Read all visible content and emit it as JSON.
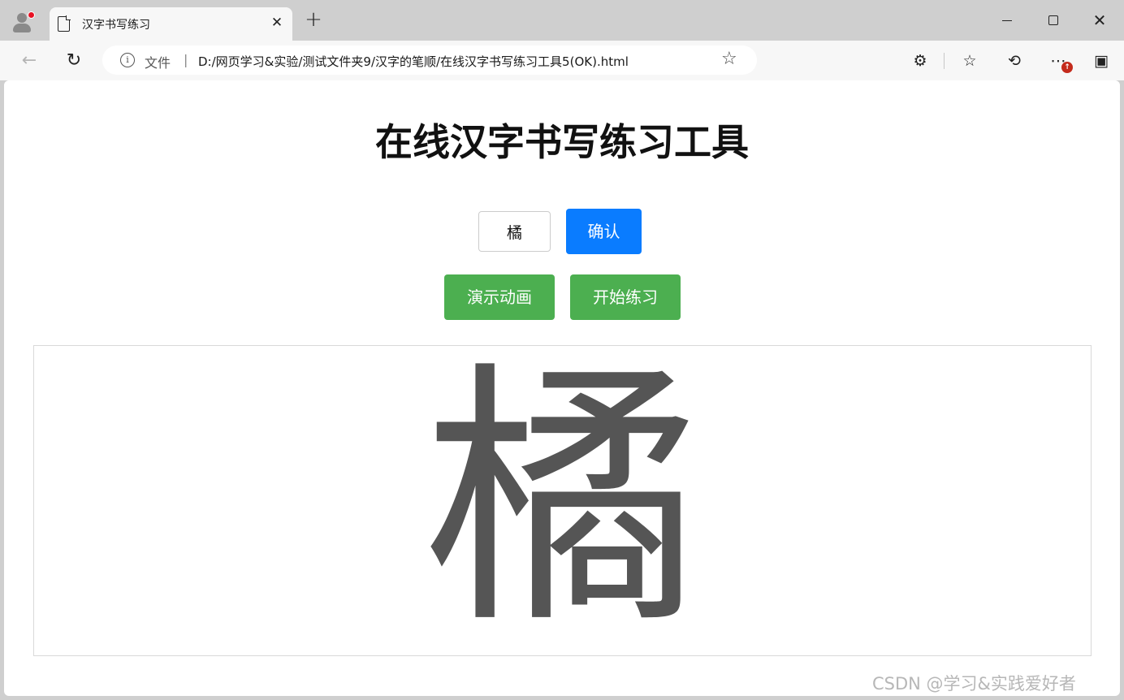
{
  "browser": {
    "tab_title": "汉字书写练习",
    "tab_close": "✕",
    "new_tab": "+",
    "address": {
      "scheme_label": "文件",
      "separator": "|",
      "url": "D:/网页学习&实验/测试文件夹9/汉字的笔顺/在线汉字书写练习工具5(OK).html"
    },
    "notification_badge": "↑",
    "colors": {
      "titlebar": "#cfcfcf",
      "toolbar": "#f7f7f7",
      "badge": "#c42b1c"
    }
  },
  "page": {
    "title": "在线汉字书写练习工具",
    "input_value": "橘",
    "confirm_label": "确认",
    "demo_label": "演示动画",
    "practice_label": "开始练习",
    "displayed_character": "橘",
    "colors": {
      "confirm": "#0a7cff",
      "action": "#4caf50",
      "character": "#555555"
    }
  },
  "watermark": "CSDN @学习&实践爱好者"
}
